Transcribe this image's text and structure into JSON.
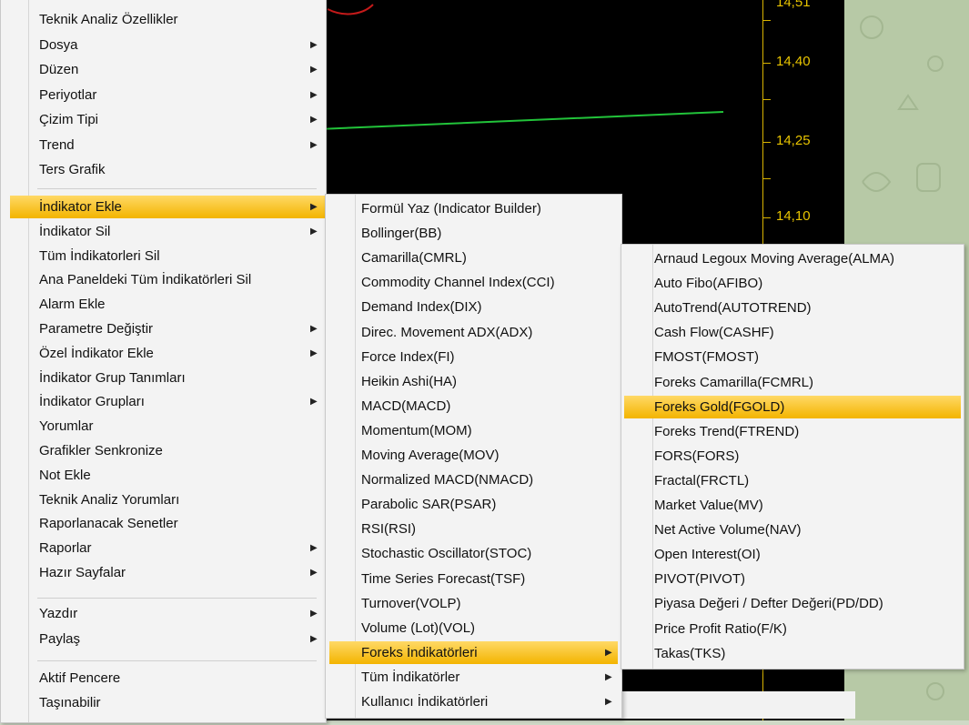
{
  "chart": {
    "price_labels": [
      "14,51",
      "14,40",
      "14,25",
      "14,10"
    ]
  },
  "menu_main": {
    "items": [
      {
        "label": "Teknik Analiz Özellikler",
        "arrow": false
      },
      {
        "label": "Dosya",
        "arrow": true
      },
      {
        "label": "Düzen",
        "arrow": true
      },
      {
        "label": "Periyotlar",
        "arrow": true
      },
      {
        "label": "Çizim Tipi",
        "arrow": true
      },
      {
        "label": "Trend",
        "arrow": true
      },
      {
        "label": "Ters Grafik",
        "arrow": false
      },
      {
        "label": "İndikator Ekle",
        "arrow": true,
        "highlighted": true
      },
      {
        "label": "İndikator Sil",
        "arrow": true
      },
      {
        "label": "Tüm İndikatorleri Sil",
        "arrow": false
      },
      {
        "label": "Ana Paneldeki Tüm İndikatörleri Sil",
        "arrow": false
      },
      {
        "label": "Alarm Ekle",
        "arrow": false
      },
      {
        "label": "Parametre Değiştir",
        "arrow": true
      },
      {
        "label": "Özel İndikator Ekle",
        "arrow": true
      },
      {
        "label": "İndikator Grup Tanımları",
        "arrow": false
      },
      {
        "label": "İndikator Grupları",
        "arrow": true
      },
      {
        "label": "Yorumlar",
        "arrow": false
      },
      {
        "label": "Grafikler Senkronize",
        "arrow": false
      },
      {
        "label": "Not Ekle",
        "arrow": false
      },
      {
        "label": "Teknik Analiz Yorumları",
        "arrow": false
      },
      {
        "label": "Raporlanacak Senetler",
        "arrow": false
      },
      {
        "label": "Raporlar",
        "arrow": true
      },
      {
        "label": "Hazır Sayfalar",
        "arrow": true
      },
      {
        "label": "Yazdır",
        "arrow": true
      },
      {
        "label": "Paylaş",
        "arrow": true
      },
      {
        "label": "Aktif Pencere",
        "arrow": false
      },
      {
        "label": "Taşınabilir",
        "arrow": false
      }
    ]
  },
  "menu_indicators": {
    "items": [
      {
        "label": "Formül Yaz (Indicator Builder)",
        "arrow": false
      },
      {
        "label": "Bollinger(BB)",
        "arrow": false
      },
      {
        "label": "Camarilla(CMRL)",
        "arrow": false
      },
      {
        "label": "Commodity Channel Index(CCI)",
        "arrow": false
      },
      {
        "label": "Demand Index(DIX)",
        "arrow": false
      },
      {
        "label": "Direc. Movement ADX(ADX)",
        "arrow": false
      },
      {
        "label": "Force Index(FI)",
        "arrow": false
      },
      {
        "label": "Heikin Ashi(HA)",
        "arrow": false
      },
      {
        "label": "MACD(MACD)",
        "arrow": false
      },
      {
        "label": "Momentum(MOM)",
        "arrow": false
      },
      {
        "label": "Moving Average(MOV)",
        "arrow": false
      },
      {
        "label": "Normalized MACD(NMACD)",
        "arrow": false
      },
      {
        "label": "Parabolic SAR(PSAR)",
        "arrow": false
      },
      {
        "label": "RSI(RSI)",
        "arrow": false
      },
      {
        "label": "Stochastic Oscillator(STOC)",
        "arrow": false
      },
      {
        "label": "Time Series Forecast(TSF)",
        "arrow": false
      },
      {
        "label": "Turnover(VOLP)",
        "arrow": false
      },
      {
        "label": "Volume (Lot)(VOL)",
        "arrow": false
      },
      {
        "label": "Foreks İndikatörleri",
        "arrow": true,
        "highlighted": true
      },
      {
        "label": "Tüm İndikatörler",
        "arrow": true
      },
      {
        "label": "Kullanıcı İndikatörleri",
        "arrow": true
      }
    ]
  },
  "menu_foreks": {
    "items": [
      {
        "label": "Arnaud Legoux Moving Average(ALMA)"
      },
      {
        "label": "Auto Fibo(AFIBO)"
      },
      {
        "label": "AutoTrend(AUTOTREND)"
      },
      {
        "label": "Cash Flow(CASHF)"
      },
      {
        "label": "FMOST(FMOST)"
      },
      {
        "label": "Foreks Camarilla(FCMRL)"
      },
      {
        "label": "Foreks Gold(FGOLD)",
        "highlighted": true
      },
      {
        "label": "Foreks Trend(FTREND)"
      },
      {
        "label": "FORS(FORS)"
      },
      {
        "label": "Fractal(FRCTL)"
      },
      {
        "label": "Market Value(MV)"
      },
      {
        "label": "Net Active Volume(NAV)"
      },
      {
        "label": "Open Interest(OI)"
      },
      {
        "label": "PIVOT(PIVOT)"
      },
      {
        "label": "Piyasa Değeri / Defter Değeri(PD/DD)"
      },
      {
        "label": "Price Profit Ratio(F/K)"
      },
      {
        "label": "Takas(TKS)"
      }
    ]
  },
  "colors": {
    "highlight": "#f3b400",
    "axis": "#d9b400",
    "trend_line": "#22c33a"
  }
}
